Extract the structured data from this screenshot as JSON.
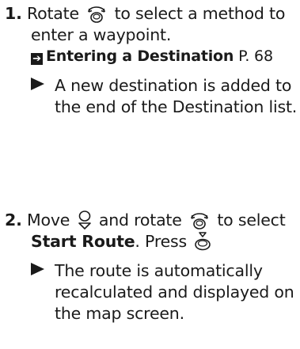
{
  "step1": {
    "number": "1.",
    "line1_pre": "Rotate",
    "line1_post": "to select a method to",
    "line2": "enter a waypoint.",
    "ref_title": "Entering a Destination",
    "ref_page": "P. 68",
    "result_line1": "A new destination is added to",
    "result_line2": "the end of the Destination list.",
    "icons": [
      "rotate-knob-icon",
      "reference-arrow-icon",
      "result-triangle-icon"
    ]
  },
  "step2": {
    "number": "2.",
    "line1_pre": "Move",
    "line1_mid": "and rotate",
    "line1_post": "to select",
    "line2_bold": "Start Route",
    "line2_post": ". Press",
    "result_lines": [
      "The route is automatically",
      "recalculated and displayed on",
      "the map screen."
    ],
    "icons": [
      "move-down-icon",
      "rotate-knob-icon",
      "press-knob-icon",
      "result-triangle-icon"
    ]
  }
}
